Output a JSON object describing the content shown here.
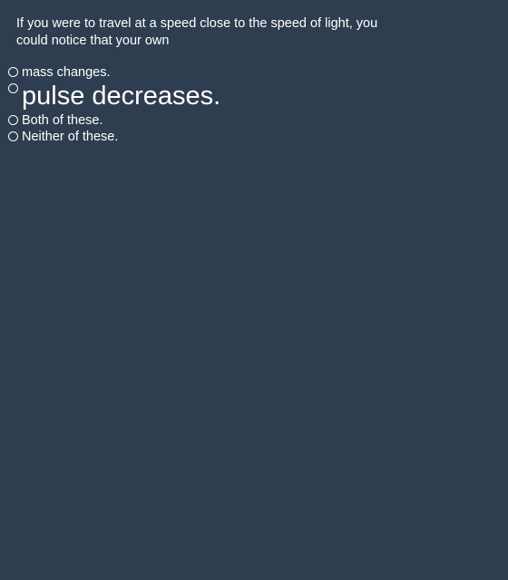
{
  "question": {
    "text": "If you were to travel at a speed close to the speed of light, you could notice that your own"
  },
  "options": [
    {
      "label": "mass changes."
    },
    {
      "label": "pulse decreases."
    },
    {
      "label": "Both of these."
    },
    {
      "label": "Neither of these."
    }
  ],
  "colors": {
    "background": "#2e3d4f",
    "text": "#ffffff"
  }
}
